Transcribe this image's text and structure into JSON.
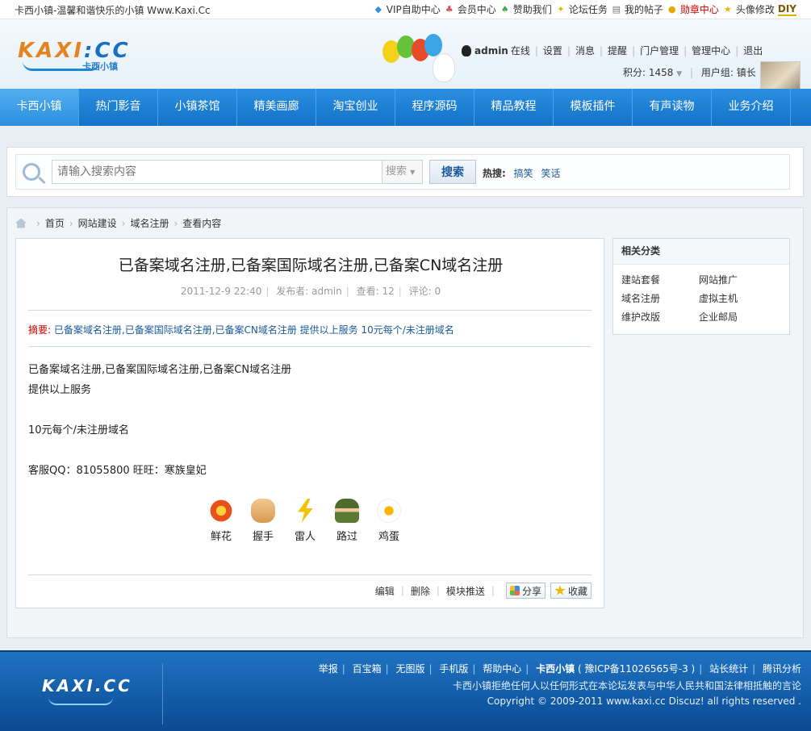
{
  "topbar": {
    "slogan": "卡西小镇-温馨和谐快乐的小镇 Www.Kaxi.Cc",
    "links": [
      "VIP自助中心",
      "会员中心",
      "赞助我们",
      "论坛任务",
      "我的帖子",
      "勋章中心",
      "头像修改"
    ],
    "diy": "DIY"
  },
  "header": {
    "logo_text": "KAXI",
    "logo_cc": "CC",
    "logo_sub": "卡西小镇",
    "username": "admin",
    "online": "在线",
    "user_links": [
      "设置",
      "消息",
      "提醒",
      "门户管理",
      "管理中心",
      "退出"
    ],
    "credits": "积分: 1458",
    "group": "用户组: 镇长"
  },
  "nav": [
    "卡西小镇",
    "热门影音",
    "小镇茶馆",
    "精美画廊",
    "淘宝创业",
    "程序源码",
    "精品教程",
    "模板插件",
    "有声读物",
    "业务介绍"
  ],
  "search": {
    "placeholder": "请输入搜索内容",
    "scope": "搜索",
    "button": "搜索",
    "hot_label": "热搜:",
    "hot_terms": [
      "搞笑",
      "笑话"
    ]
  },
  "breadcrumb": [
    "首页",
    "网站建设",
    "域名注册",
    "查看内容"
  ],
  "article": {
    "title": "已备案域名注册,已备案国际域名注册,已备案CN域名注册",
    "date": "2011-12-9 22:40",
    "author_label": "发布者: admin",
    "views": "查看: 12",
    "comments": "评论: 0",
    "summary_label": "摘要:",
    "summary": "已备案域名注册,已备案国际域名注册,已备案CN域名注册 提供以上服务 10元每个/未注册域名",
    "body": [
      "已备案域名注册,已备案国际域名注册,已备案CN域名注册",
      "提供以上服务",
      "",
      "10元每个/未注册域名",
      "",
      "客服QQ：81055800 旺旺：寒族皇妃"
    ],
    "reactions": [
      "鲜花",
      "握手",
      "雷人",
      "路过",
      "鸡蛋"
    ],
    "actions": [
      "编辑",
      "删除",
      "模块推送"
    ],
    "share": "分享",
    "favorite": "收藏"
  },
  "sidebar": {
    "title": "相关分类",
    "items": [
      "建站套餐",
      "网站推广",
      "域名注册",
      "虚拟主机",
      "维护改版",
      "企业邮局"
    ]
  },
  "footer": {
    "logo": "KAXI.CC",
    "links": [
      "举报",
      "百宝箱",
      "无图版",
      "手机版",
      "帮助中心"
    ],
    "site_name": "卡西小镇",
    "icp": "( 豫ICP备11026565号-3 )",
    "stats": "站长统计",
    "analytics": "腾讯分析",
    "disclaimer": "卡西小镇拒绝任何人以任何形式在本论坛发表与中华人民共和国法律相抵触的言论",
    "copyright": "Copyright © 2009-2011 www.kaxi.cc Discuz! all rights reserved ."
  }
}
